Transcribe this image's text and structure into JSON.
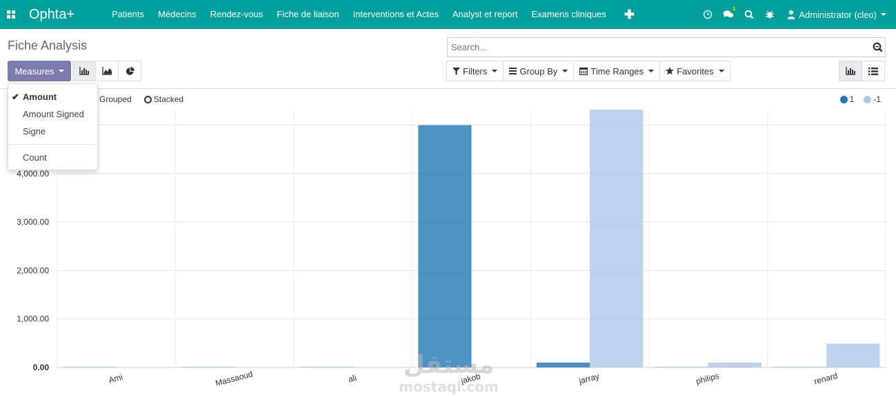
{
  "navbar": {
    "brand": "Ophta+",
    "menu": [
      "Patients",
      "Médecins",
      "Rendez-vous",
      "Fiche de liaison",
      "Interventions et Actes",
      "Analyst et report",
      "Examens cliniques"
    ],
    "plus": "✚",
    "chat_badge": "1",
    "user": "Administrator (cleo)"
  },
  "control_panel": {
    "title": "Fiche Analysis",
    "search_placeholder": "Search...",
    "measures_label": "Measures",
    "filters_label": "Filters",
    "group_by_label": "Group By",
    "time_ranges_label": "Time Ranges",
    "favorites_label": "Favorites"
  },
  "measures_menu": {
    "items": [
      "Amount",
      "Amount Signed",
      "Signe"
    ],
    "checked": "Amount",
    "count": "Count"
  },
  "stack_options": {
    "grouped": "Grouped",
    "stacked": "Stacked"
  },
  "colors": {
    "series_1": "#1f77b4",
    "series_minus1": "#aec7e8",
    "navbar": "#00a09d",
    "measures_button": "#7c7bad"
  },
  "chart_data": {
    "type": "bar",
    "categories": [
      "Ami",
      "Massaoud",
      "ali",
      "jakob",
      "jarray",
      "philips",
      "renard"
    ],
    "series": [
      {
        "name": "1",
        "values": [
          5,
          5,
          5,
          5000,
          100,
          5,
          5
        ]
      },
      {
        "name": "-1",
        "values": [
          0,
          0,
          0,
          0,
          5370,
          100,
          490
        ]
      }
    ],
    "yticks": [
      "0.00",
      "1,000.00",
      "2,000.00",
      "3,000.00",
      "4,000.00"
    ],
    "ylim": [
      0,
      5370
    ],
    "grid": true,
    "legend_position": "top-right"
  },
  "watermark": {
    "arabic": "مستقل",
    "latin": "mostaql.com"
  }
}
